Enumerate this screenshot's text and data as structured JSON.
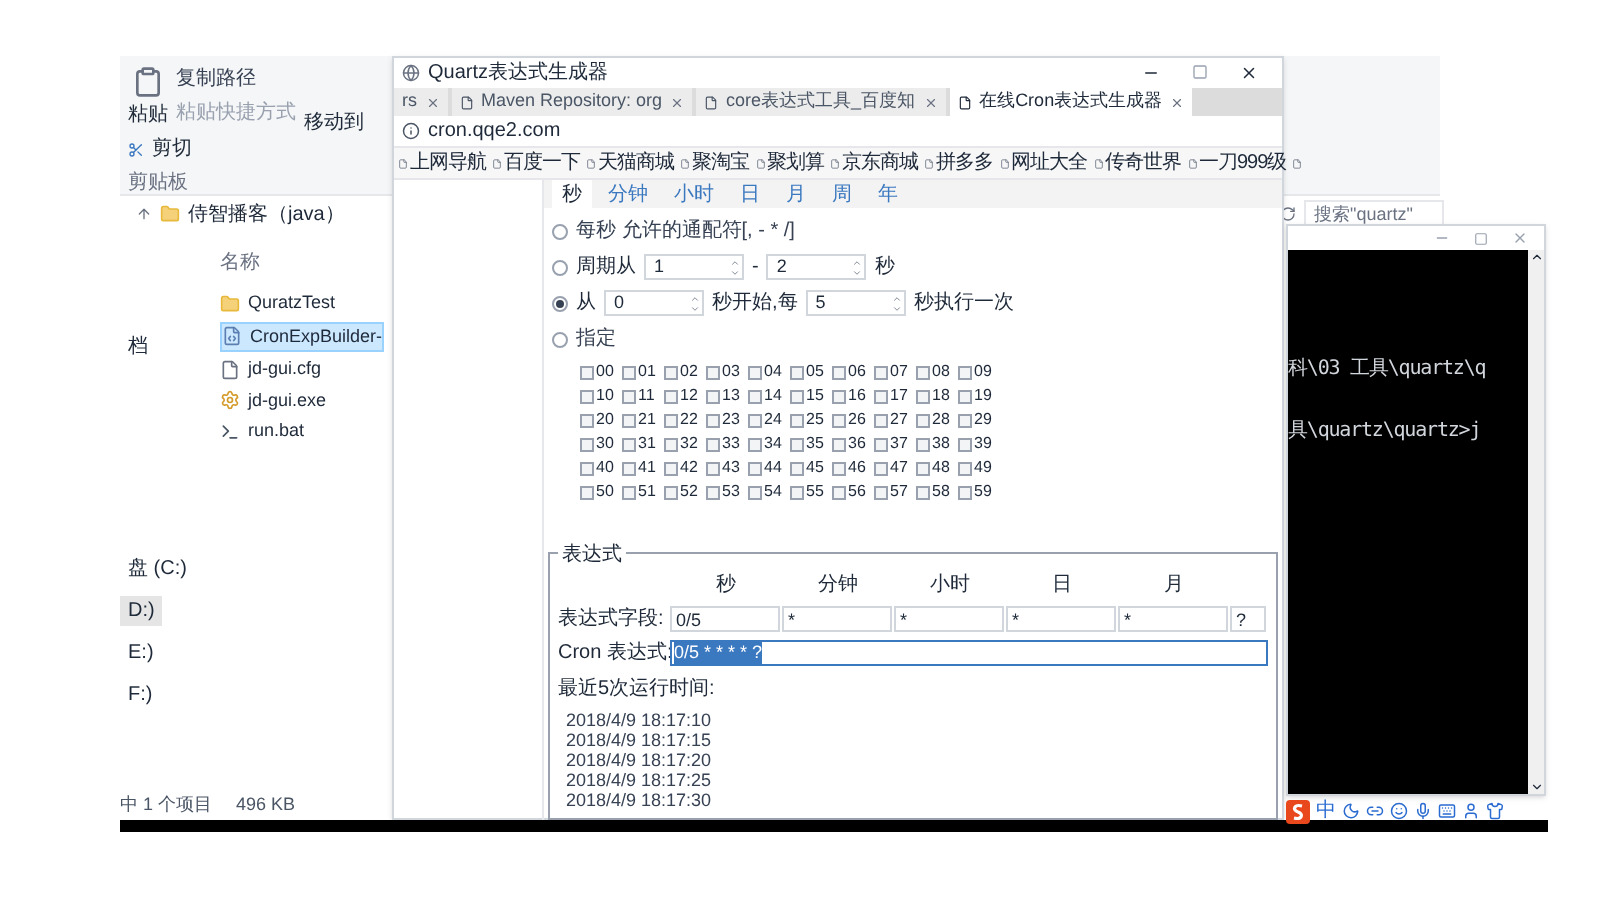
{
  "explorer": {
    "ribbon": {
      "paste": "粘贴",
      "copy_path": "复制路径",
      "paste_shortcut": "粘贴快捷方式",
      "cut": "剪切",
      "group": "剪贴板",
      "move_to": "移动到"
    },
    "breadcrumb": [
      "侍智播客（java）"
    ],
    "search": {
      "placeholder": "搜索\"quartz\""
    },
    "nav": [
      {
        "label": "档",
        "selected": false
      },
      {
        "label": "盘 (C:)",
        "selected": false
      },
      {
        "label": "D:)",
        "selected": true
      },
      {
        "label": "E:)",
        "selected": false
      },
      {
        "label": "F:)",
        "selected": false
      }
    ],
    "column": "名称",
    "files": [
      {
        "kind": "folder",
        "name": "QuratzTest",
        "selected": false
      },
      {
        "kind": "jar",
        "name": "CronExpBuilder-",
        "selected": true
      },
      {
        "kind": "file",
        "name": "jd-gui.cfg",
        "selected": false
      },
      {
        "kind": "exe",
        "name": "jd-gui.exe",
        "selected": false
      },
      {
        "kind": "bat",
        "name": "run.bat",
        "selected": false
      }
    ],
    "status": [
      "中 1 个项目",
      "496 KB"
    ]
  },
  "browser": {
    "title": "Quartz表达式生成器",
    "tabs": [
      {
        "label": "rs",
        "selected": false
      },
      {
        "label": "Maven Repository: org",
        "selected": false
      },
      {
        "label": "core表达式工具_百度知",
        "selected": false
      },
      {
        "label": "在线Cron表达式生成器",
        "selected": true
      }
    ],
    "url": "cron.qqe2.com",
    "bookmarks": [
      "上网导航",
      "百度一下",
      "天猫商城",
      "聚淘宝",
      "聚划算",
      "京东商城",
      "拼多多",
      "网址大全",
      "传奇世界",
      "一刀999级"
    ]
  },
  "page": {
    "tabs": [
      {
        "label": "秒",
        "selected": true
      },
      {
        "label": "分钟",
        "selected": false
      },
      {
        "label": "小时",
        "selected": false
      },
      {
        "label": "日",
        "selected": false
      },
      {
        "label": "月",
        "selected": false
      },
      {
        "label": "周",
        "selected": false
      },
      {
        "label": "年",
        "selected": false
      }
    ],
    "options": [
      {
        "kind": "plain",
        "label": "每秒 允许的通配符[, - * /]",
        "selected": false
      },
      {
        "kind": "range",
        "prefix": "周期从",
        "a": "1",
        "sep": "-",
        "b": "2",
        "suffix": "秒",
        "selected": false
      },
      {
        "kind": "range",
        "prefix": "从",
        "a": "0",
        "sep": "秒开始,每",
        "b": "5",
        "suffix": "秒执行一次",
        "selected": true
      },
      {
        "kind": "plain",
        "label": "指定",
        "selected": false
      }
    ],
    "seconds": [
      {
        "label": "00",
        "checked": false
      },
      {
        "label": "01",
        "checked": false
      },
      {
        "label": "02",
        "checked": false
      },
      {
        "label": "03",
        "checked": false
      },
      {
        "label": "04",
        "checked": false
      },
      {
        "label": "05",
        "checked": false
      },
      {
        "label": "06",
        "checked": false
      },
      {
        "label": "07",
        "checked": false
      },
      {
        "label": "08",
        "checked": false
      },
      {
        "label": "09",
        "checked": false
      },
      {
        "label": "10",
        "checked": false
      },
      {
        "label": "11",
        "checked": false
      },
      {
        "label": "12",
        "checked": false
      },
      {
        "label": "13",
        "checked": false
      },
      {
        "label": "14",
        "checked": false
      },
      {
        "label": "15",
        "checked": false
      },
      {
        "label": "16",
        "checked": false
      },
      {
        "label": "17",
        "checked": false
      },
      {
        "label": "18",
        "checked": false
      },
      {
        "label": "19",
        "checked": false
      },
      {
        "label": "20",
        "checked": false
      },
      {
        "label": "21",
        "checked": false
      },
      {
        "label": "22",
        "checked": false
      },
      {
        "label": "23",
        "checked": false
      },
      {
        "label": "24",
        "checked": false
      },
      {
        "label": "25",
        "checked": false
      },
      {
        "label": "26",
        "checked": false
      },
      {
        "label": "27",
        "checked": false
      },
      {
        "label": "28",
        "checked": false
      },
      {
        "label": "29",
        "checked": false
      },
      {
        "label": "30",
        "checked": false
      },
      {
        "label": "31",
        "checked": false
      },
      {
        "label": "32",
        "checked": false
      },
      {
        "label": "33",
        "checked": false
      },
      {
        "label": "34",
        "checked": false
      },
      {
        "label": "35",
        "checked": false
      },
      {
        "label": "36",
        "checked": false
      },
      {
        "label": "37",
        "checked": false
      },
      {
        "label": "38",
        "checked": false
      },
      {
        "label": "39",
        "checked": false
      },
      {
        "label": "40",
        "checked": false
      },
      {
        "label": "41",
        "checked": false
      },
      {
        "label": "42",
        "checked": false
      },
      {
        "label": "43",
        "checked": false
      },
      {
        "label": "44",
        "checked": false
      },
      {
        "label": "45",
        "checked": false
      },
      {
        "label": "46",
        "checked": false
      },
      {
        "label": "47",
        "checked": false
      },
      {
        "label": "48",
        "checked": false
      },
      {
        "label": "49",
        "checked": false
      },
      {
        "label": "50",
        "checked": false
      },
      {
        "label": "51",
        "checked": false
      },
      {
        "label": "52",
        "checked": false
      },
      {
        "label": "53",
        "checked": false
      },
      {
        "label": "54",
        "checked": false
      },
      {
        "label": "55",
        "checked": false
      },
      {
        "label": "56",
        "checked": false
      },
      {
        "label": "57",
        "checked": false
      },
      {
        "label": "58",
        "checked": false
      },
      {
        "label": "59",
        "checked": false
      }
    ],
    "expression": {
      "legend": "表达式",
      "headers": [
        "秒",
        "分钟",
        "小时",
        "日",
        "月"
      ],
      "field_label": "表达式字段:",
      "fields": [
        "0/5",
        "*",
        "*",
        "*",
        "*",
        "?"
      ],
      "cron_label": "Cron 表达式:",
      "cron_value": "0/5 * * * * ?",
      "cron_selected": true,
      "runs_label": "最近5次运行时间:",
      "runs": [
        "2018/4/9 18:17:10",
        "2018/4/9 18:17:15",
        "2018/4/9 18:17:20",
        "2018/4/9 18:17:25",
        "2018/4/9 18:17:30"
      ]
    }
  },
  "console": {
    "lines": [
      "科\\03 工具\\quartz\\q",
      "具\\quartz\\quartz>j"
    ]
  },
  "tray": {
    "ime": "中"
  }
}
